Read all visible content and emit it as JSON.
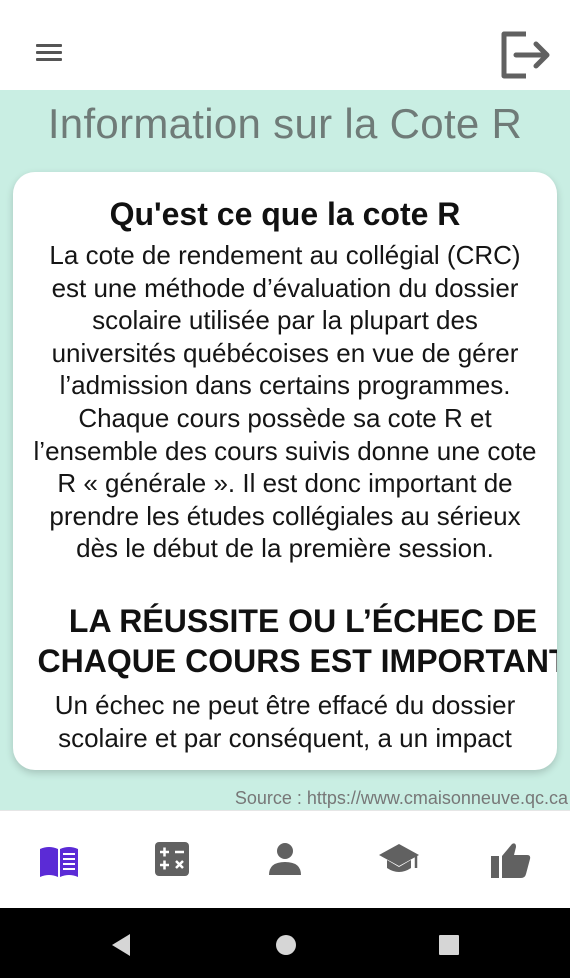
{
  "page": {
    "title": "Information sur la Cote R",
    "source": "Source : https://www.cmaisonneuve.qc.ca"
  },
  "card": {
    "heading": "Qu'est ce que la cote R",
    "body": "La cote de rendement au collégial (CRC) est une méthode d’évaluation du dossier scolaire utilisée par la plupart des universités québécoises en vue de gérer l’admission dans certains programmes. Chaque cours possède sa cote R et l’ensemble des cours suivis donne une cote R « générale ». Il est donc important de prendre les études collégiales au sérieux dès le début de la première session.",
    "section2_heading": "LA RÉUSSITE OU L’ÉCHEC DE CHAQUE COURS EST IMPORTANT",
    "section2_body": "Un échec ne peut être effacé du dossier scolaire et par conséquent, a un impact"
  },
  "icons": {
    "menu": "menu-icon",
    "logout": "logout-icon",
    "nav": [
      "book-icon",
      "calculator-icon",
      "person-icon",
      "graduation-cap-icon",
      "thumb-up-icon"
    ],
    "system": [
      "back-icon",
      "home-icon",
      "recents-icon"
    ]
  },
  "colors": {
    "accent": "#5b2bd6",
    "nav_icon": "#616161",
    "content_bg": "#c9eee3",
    "title": "#6f7b78"
  }
}
